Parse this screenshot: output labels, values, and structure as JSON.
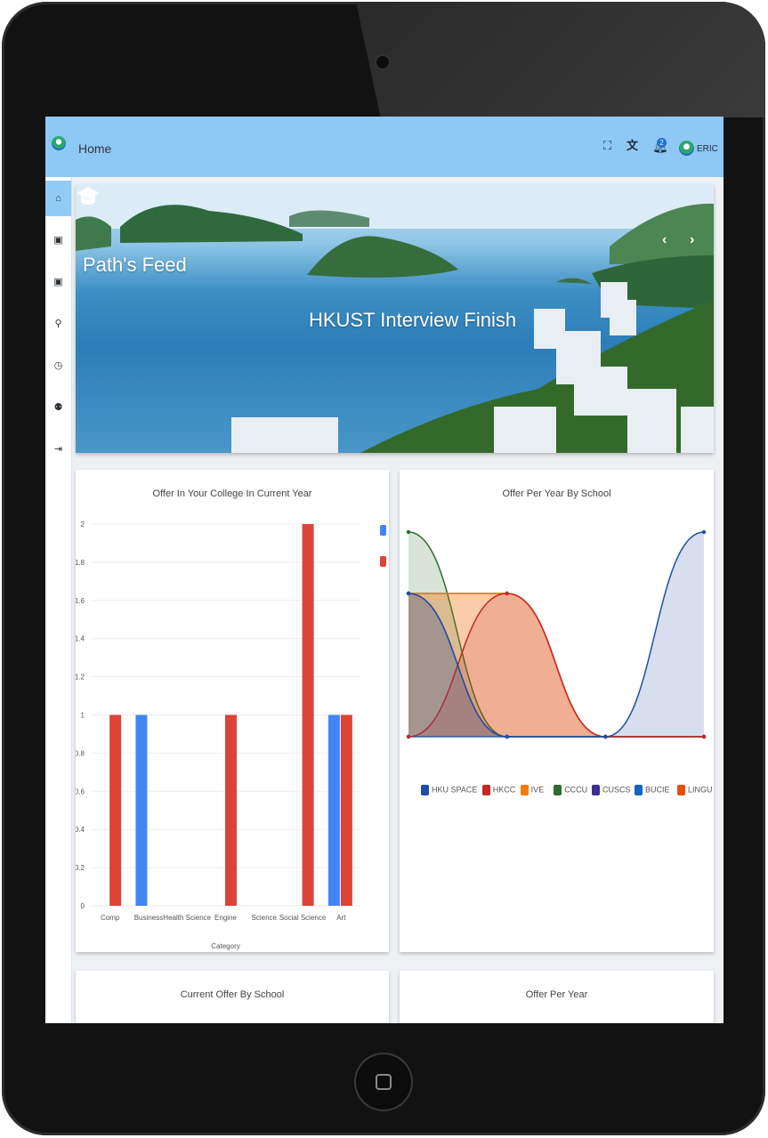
{
  "header": {
    "title": "Home",
    "username": "ERIC",
    "notification_count": "2"
  },
  "icons": {
    "fullscreen": "fullscreen-icon",
    "translate": "translate-icon",
    "bell": "bell-icon"
  },
  "sidebar": {
    "items": [
      {
        "icon": "home-icon",
        "glyph": "⌂"
      },
      {
        "icon": "book-icon",
        "glyph": "▣"
      },
      {
        "icon": "book-icon",
        "glyph": "▣"
      },
      {
        "icon": "search-icon",
        "glyph": "⚲"
      },
      {
        "icon": "clock-icon",
        "glyph": "◷"
      },
      {
        "icon": "people-icon",
        "glyph": "⚉"
      },
      {
        "icon": "logout-icon",
        "glyph": "⇥"
      }
    ]
  },
  "banner": {
    "brand": "Path's Feed",
    "caption": "HKUST Interview Finish",
    "prev": "‹",
    "next": "›"
  },
  "cards": {
    "college": "Offer In Your College In Current Year",
    "school": "Offer Per Year By School",
    "current": "Current Offer By School",
    "per_year": "Offer Per Year"
  },
  "colors": {
    "blue": "#4285f4",
    "red": "#db4437",
    "topbar": "#8ec8f5"
  },
  "chart_data": [
    {
      "type": "bar",
      "title": "Offer In Your College In Current Year",
      "xlabel": "Category",
      "categories": [
        "Comp",
        "Business",
        "Health Science",
        "Engine",
        "Science",
        "Social Science",
        "Art"
      ],
      "series": [
        {
          "color": "#4285f4",
          "values": [
            0,
            1,
            0,
            0,
            0,
            0,
            1
          ]
        },
        {
          "color": "#db4437",
          "values": [
            1,
            0,
            0,
            1,
            0,
            2,
            1
          ]
        }
      ],
      "ylim": [
        0,
        2
      ],
      "yticks": [
        "0",
        "0.2",
        "0.4",
        "0.6",
        "0.8",
        "1",
        "1.2",
        "1.4",
        "1.6",
        "1.8",
        "2"
      ],
      "legend": "top-right"
    },
    {
      "type": "area",
      "title": "Offer Per Year By School",
      "x": [
        0,
        1,
        2,
        3
      ],
      "series": [
        {
          "name": "HKU SPACE",
          "color": "#1f4fa5",
          "values": [
            1.4,
            0,
            0,
            2
          ]
        },
        {
          "name": "HKCC",
          "color": "#c62828",
          "values": [
            0,
            1.4,
            0,
            0
          ]
        },
        {
          "name": "IVE",
          "color": "#f57c00",
          "values": [
            1.4,
            1.4,
            0,
            0
          ]
        },
        {
          "name": "CCCU",
          "color": "#2e6b2e",
          "values": [
            2,
            0,
            0,
            0
          ]
        },
        {
          "name": "CUSCS",
          "color": "#3d2f91",
          "values": [
            1.4,
            0,
            0,
            0
          ]
        },
        {
          "name": "BUCIE",
          "color": "#1565c0",
          "values": [
            0,
            0,
            0,
            0
          ]
        },
        {
          "name": "LINGU",
          "color": "#e65100",
          "values": [
            1.4,
            1.4,
            0,
            0
          ]
        }
      ],
      "ylim": [
        0,
        2
      ],
      "legend": "bottom"
    }
  ]
}
